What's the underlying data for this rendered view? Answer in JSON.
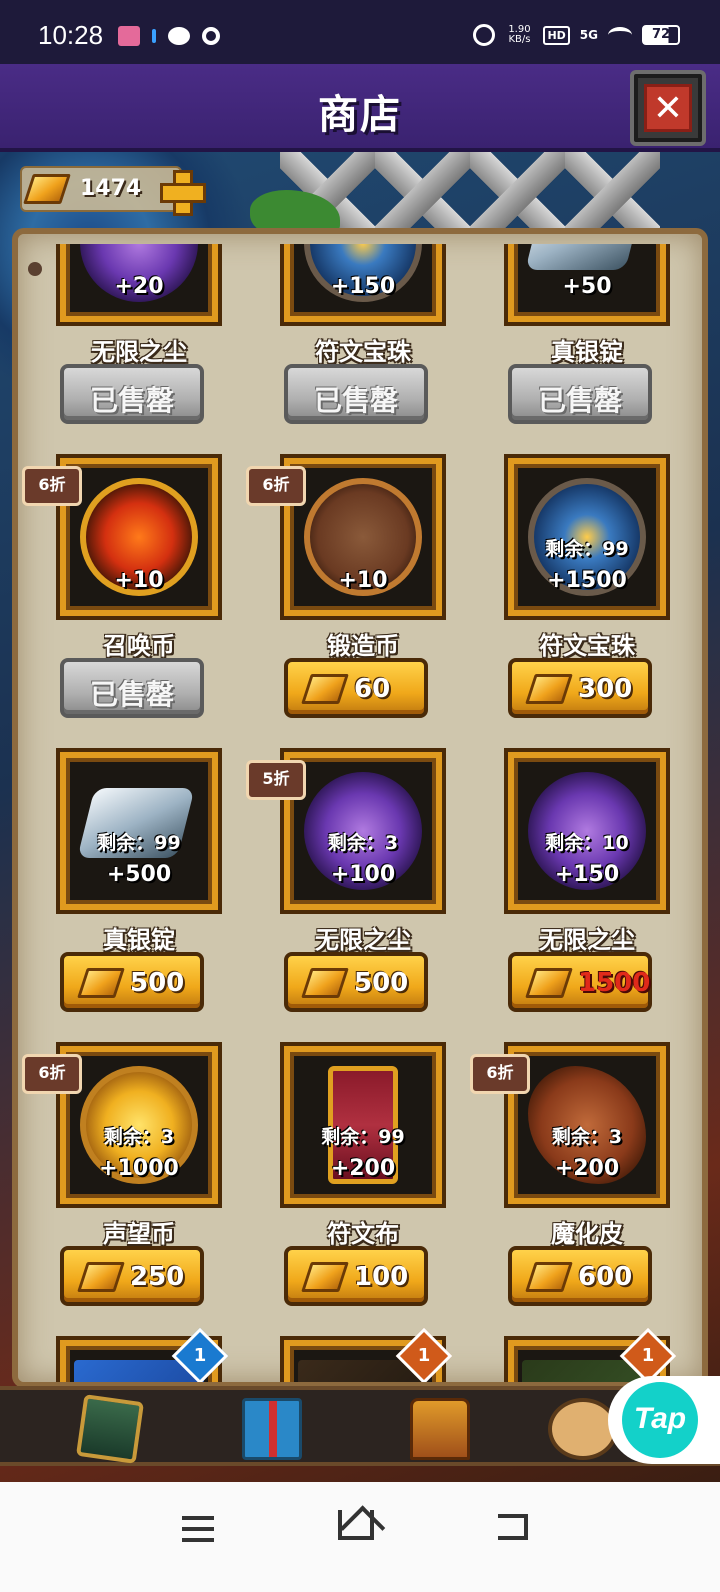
{
  "status_bar": {
    "time": "10:28",
    "net_speed": "1.90 KB/s",
    "hd": "HD",
    "network": "5G",
    "battery": "72"
  },
  "header": {
    "title": "商店",
    "close_icon": "close-icon"
  },
  "currency": {
    "amount": "1474"
  },
  "rows": [
    [
      {
        "name": "无限之尘",
        "qty": "+20",
        "sold": true,
        "button": "已售罄",
        "art": "dust"
      },
      {
        "name": "符文宝珠",
        "qty": "+150",
        "sold": true,
        "button": "已售罄",
        "art": "rune"
      },
      {
        "name": "真银锭",
        "qty": "+50",
        "sold": true,
        "button": "已售罄",
        "art": "silver"
      }
    ],
    [
      {
        "name": "召唤币",
        "qty": "+10",
        "badge": "6折",
        "sold": true,
        "button": "已售罄",
        "art": "summon"
      },
      {
        "name": "锻造币",
        "qty": "+10",
        "badge": "6折",
        "price": "60",
        "art": "forge"
      },
      {
        "name": "符文宝珠",
        "qty": "+1500",
        "remain": "剩余：99",
        "price": "300",
        "art": "rune"
      }
    ],
    [
      {
        "name": "真银锭",
        "qty": "+500",
        "remain": "剩余：99",
        "price": "500",
        "art": "silver"
      },
      {
        "name": "无限之尘",
        "qty": "+100",
        "badge": "5折",
        "remain": "剩余：3",
        "price": "500",
        "art": "dust"
      },
      {
        "name": "无限之尘",
        "qty": "+150",
        "remain": "剩余：10",
        "price": "1500",
        "price_insufficient": true,
        "art": "dust"
      }
    ],
    [
      {
        "name": "声望币",
        "qty": "+1000",
        "badge": "6折",
        "remain": "剩余：3",
        "price": "250",
        "art": "fame"
      },
      {
        "name": "符文布",
        "qty": "+200",
        "remain": "剩余：99",
        "price": "100",
        "art": "cloth"
      },
      {
        "name": "魔化皮",
        "qty": "+200",
        "badge": "6折",
        "remain": "剩余：3",
        "price": "600",
        "art": "leather"
      }
    ],
    [
      {
        "gem": "1",
        "gem_color": "blue",
        "art": "card"
      },
      {
        "gem": "1",
        "gem_color": "orange",
        "art": "card2"
      },
      {
        "gem": "1",
        "gem_color": "orange",
        "art": "card3"
      }
    ]
  ],
  "bottom_nav": [
    "card-icon",
    "gift-icon",
    "chest-icon",
    "shop-icon"
  ],
  "tap_badge": "Tap",
  "colors": {
    "buy_button": "#f0a81a",
    "sold_button": "#b0b0b0",
    "insufficient_price": "#e02a1a",
    "header": "#4a2c86"
  }
}
